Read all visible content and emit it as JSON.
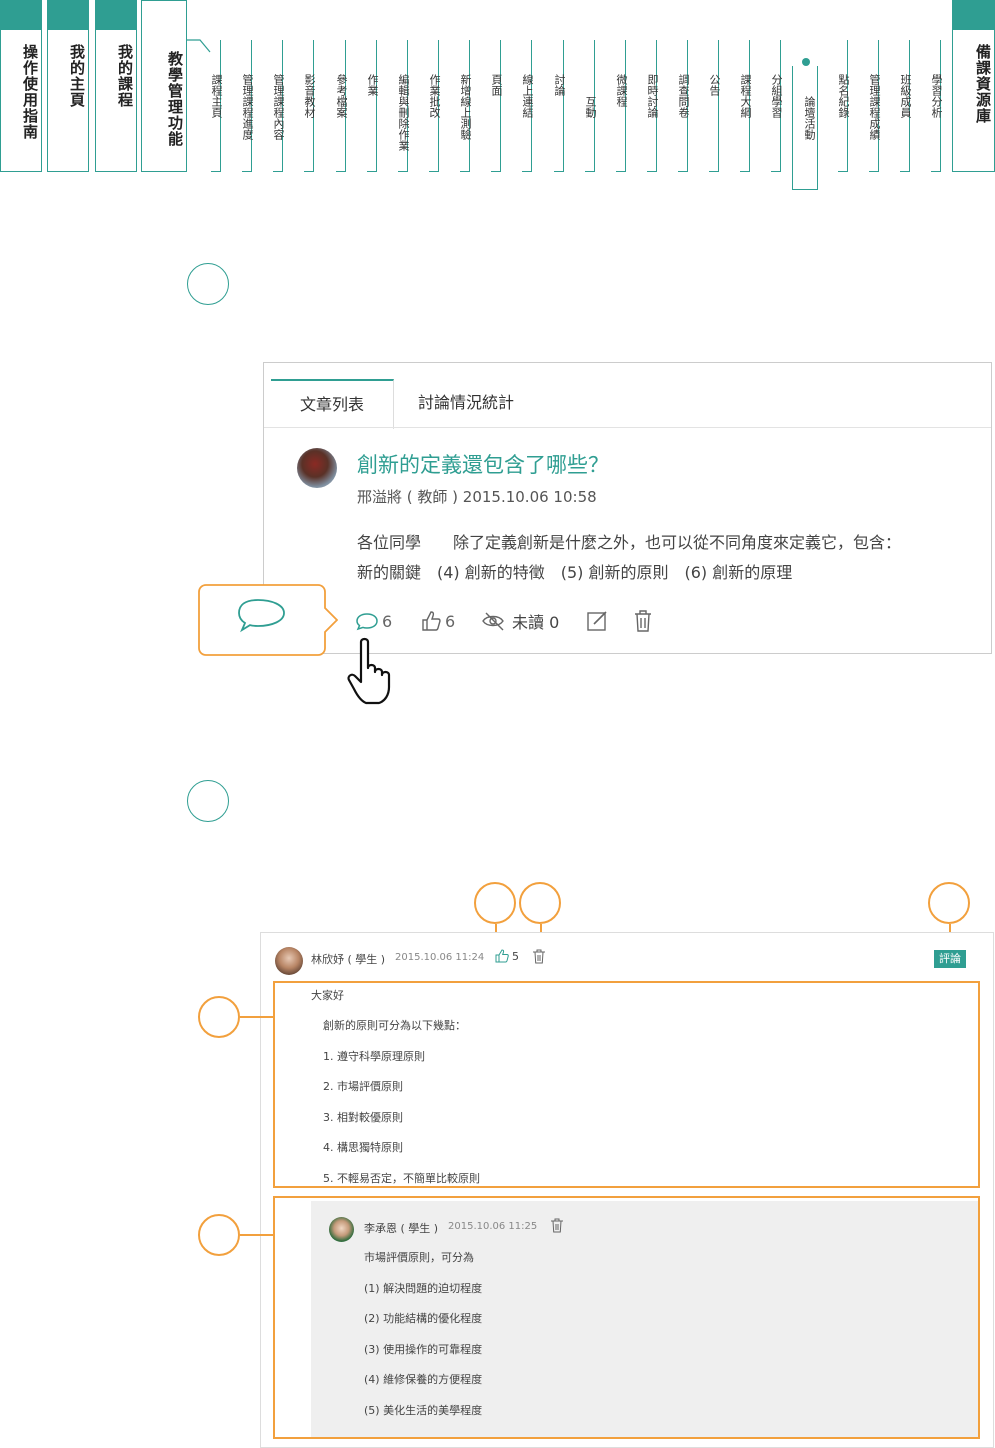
{
  "nav": {
    "big_tabs": [
      "操作使用指南",
      "我的主頁",
      "我的課程",
      "教學管理功能"
    ],
    "sub_tabs": [
      "課程主頁",
      "管理課程進度",
      "管理課程內容",
      "影音教材",
      "參考檔案",
      "作業",
      "編輯與刪除作業",
      "作業批改",
      "新增線上測驗",
      "頁面",
      "線上連結",
      "討論",
      "互動",
      "微課程",
      "即時討論",
      "調查問卷",
      "公告",
      "課程大綱",
      "分組學習",
      "論壇活動",
      "點名紀錄",
      "管理課程成績",
      "班級成員",
      "學習分析"
    ],
    "right_tab": "備課資源庫",
    "active_sub": "論壇活動"
  },
  "forum": {
    "tabs": [
      "文章列表",
      "討論情況統計"
    ],
    "post_title": "創新的定義還包含了哪些？",
    "post_meta": "邢溢將 ( 教師 ) 2015.10.06 10:58",
    "post_body_1": "各位同學　　除了定義創新是什麼之外，也可以從不同角度來定義它，包含：",
    "post_body_2": "新的關鍵　(4) 創新的特徵　(5) 創新的原則　(6) 創新的原理",
    "comment_count": "6",
    "like_count": "6",
    "unread_label": "未讀 0"
  },
  "reply": {
    "author_meta": "林欣妤 ( 學生 )",
    "time": "2015.10.06 11:24",
    "likes": "5",
    "comment_button": "評論",
    "lines": [
      "大家好",
      "創新的原則可分為以下幾點：",
      "1. 遵守科學原理原則",
      "2. 市場評價原則",
      "3. 相對較優原則",
      "4. 構思獨特原則",
      "5. 不輕易否定，不簡單比較原則"
    ]
  },
  "sub_reply": {
    "author_meta": "李承恩 ( 學生 )",
    "time": "2015.10.06 11:25",
    "lines": [
      "市場評價原則，可分為",
      "(1) 解決問題的迫切程度",
      "(2) 功能結構的優化程度",
      "(3) 使用操作的可靠程度",
      "(4) 維修保養的方便程度",
      "(5) 美化生活的美學程度"
    ]
  },
  "colors": {
    "teal": "#2f9e92",
    "orange": "#f2a03d"
  }
}
